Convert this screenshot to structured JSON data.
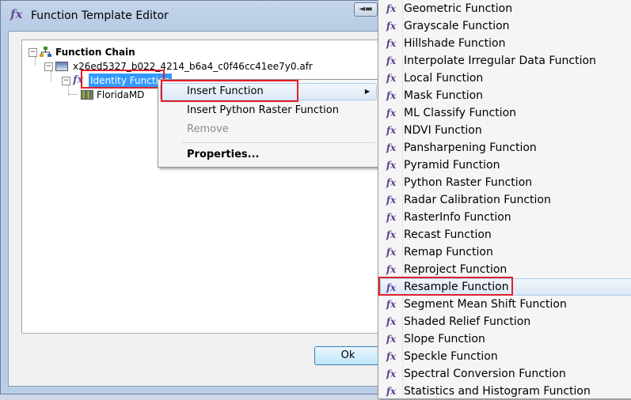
{
  "window": {
    "title": "Function Template Editor",
    "title_icon": "fx-icon"
  },
  "tree": {
    "root_label": "Function Chain",
    "template_label": "x26ed5327_b022_4214_b6a4_c0f46cc41ee7y0.afr",
    "function_label": "Identity Function",
    "raster_label": "FloridaMD"
  },
  "context_menu": {
    "items": [
      {
        "label": "Insert Function",
        "has_submenu": true
      },
      {
        "label": "Insert Python Raster Function"
      },
      {
        "label": "Remove",
        "disabled": true
      },
      {
        "label": "Properties...",
        "bold": true
      }
    ]
  },
  "submenu": {
    "items": [
      "Geometric Function",
      "Grayscale Function",
      "Hillshade Function",
      "Interpolate Irregular Data Function",
      "Local Function",
      "Mask Function",
      "ML Classify Function",
      "NDVI Function",
      "Pansharpening Function",
      "Pyramid Function",
      "Python Raster Function",
      "Radar Calibration Function",
      "RasterInfo Function",
      "Recast Function",
      "Remap Function",
      "Reproject Function",
      "Resample Function",
      "Segment Mean Shift Function",
      "Shaded Relief Function",
      "Slope Function",
      "Speckle Function",
      "Spectral Conversion Function",
      "Statistics and Histogram Function"
    ],
    "highlighted": "Resample Function"
  },
  "buttons": {
    "ok_label": "Ok"
  },
  "colors": {
    "highlight_box": "#e0202a",
    "selection": "#3399ff",
    "fx_icon": "#6b4a9c"
  }
}
